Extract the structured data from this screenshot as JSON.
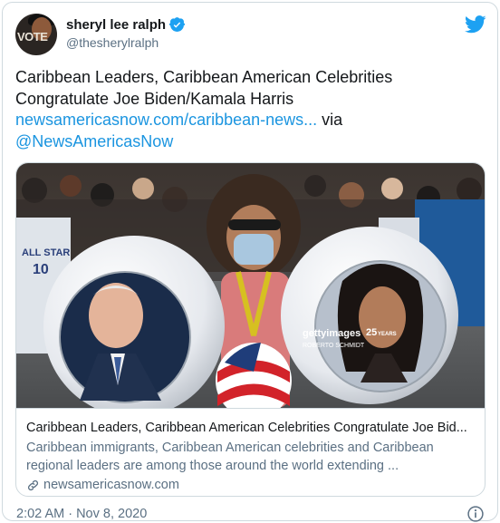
{
  "author": {
    "display_name": "sheryl lee ralph",
    "handle": "@thesherylralph",
    "avatar_text": "VOTE",
    "verified": true
  },
  "tweet": {
    "line1": "Caribbean Leaders, Caribbean American Celebrities",
    "line2": "Congratulate Joe Biden/Kamala Harris",
    "link_url": "newsamericasnow.com/caribbean-news...",
    "via_text": " via",
    "mention": "@NewsAmericasNow"
  },
  "card": {
    "title": "Caribbean Leaders, Caribbean American Celebrities Congratulate Joe Bid...",
    "description": "Caribbean immigrants, Caribbean American celebrities and Caribbean regional leaders are among those around the world extending ...",
    "domain": "newsamericasnow.com",
    "watermark_brand": "gettyimages",
    "watermark_credit": "ROBERTO SCHMIDT",
    "watermark_anniv": "25",
    "watermark_anniv_label": "YEARS",
    "shirt_text": "ALL STAR",
    "shirt_number": "10"
  },
  "footer": {
    "timestamp": "2:02 AM · Nov 8, 2020"
  },
  "colors": {
    "link": "#1b95e0",
    "twitter_blue": "#1da1f2",
    "muted": "#5b7083",
    "border": "#cfd9de"
  },
  "icons": {
    "verified": "verified-badge-icon",
    "logo": "twitter-bird-icon",
    "link": "link-icon",
    "info": "info-icon"
  }
}
